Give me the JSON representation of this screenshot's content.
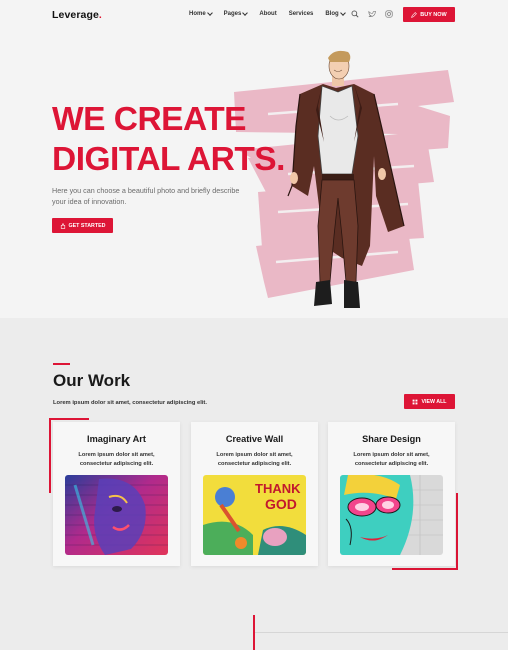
{
  "brand": {
    "name": "Leverage",
    "dot": ".",
    "accent": "#dd1536"
  },
  "nav": {
    "items": [
      {
        "label": "Home",
        "has_dropdown": true
      },
      {
        "label": "Pages",
        "has_dropdown": true
      },
      {
        "label": "About",
        "has_dropdown": false
      },
      {
        "label": "Services",
        "has_dropdown": false
      },
      {
        "label": "Blog",
        "has_dropdown": true
      }
    ],
    "icons": [
      "search-icon",
      "twitter-icon",
      "instagram-icon"
    ],
    "buy_label": "BUY NOW"
  },
  "hero": {
    "headline_line1": "WE CREATE",
    "headline_line2": "DIGITAL ARTS.",
    "description": "Here you can choose a beautiful photo and briefly describe your idea of innovation.",
    "cta_label": "GET STARTED"
  },
  "work": {
    "title": "Our Work",
    "subtitle": "Lorem ipsum dolor sit amet, consectetur adipiscing elit.",
    "view_all_label": "VIEW ALL",
    "cards": [
      {
        "title": "Imaginary Art",
        "desc": "Lorem ipsum dolor sit amet, consectetur adipiscing elit."
      },
      {
        "title": "Creative Wall",
        "desc": "Lorem ipsum dolor sit amet, consectetur adipiscing elit."
      },
      {
        "title": "Share Design",
        "desc": "Lorem ipsum dolor sit amet, consectetur adipiscing elit."
      }
    ],
    "graffiti_text": [
      "THANK",
      "GOD"
    ]
  }
}
